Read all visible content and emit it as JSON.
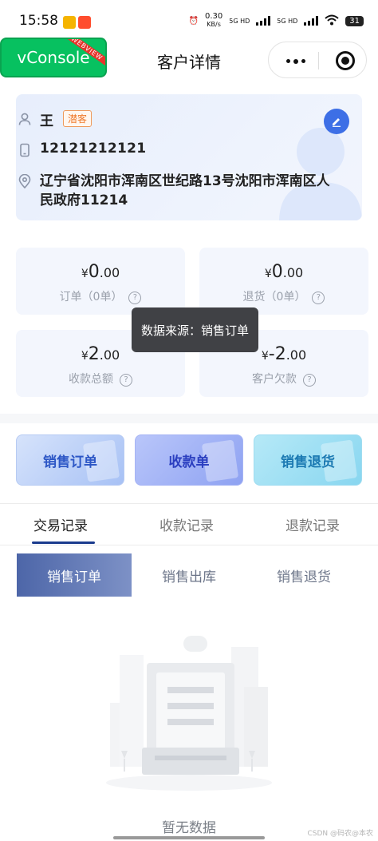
{
  "status_bar": {
    "time": "15:58",
    "network_speed": "0.30",
    "speed_unit": "KB/s",
    "sim1": "5G HD",
    "sim2": "5G HD",
    "battery": "31"
  },
  "nav": {
    "title": "客户详情",
    "vconsole_label": "vConsole",
    "vconsole_ribbon": "WEBVIEW"
  },
  "customer": {
    "name": "王",
    "tag": "潜客",
    "phone": "12121212121",
    "address": "辽宁省沈阳市浑南区世纪路13号沈阳市浑南区人民政府11214"
  },
  "stats": [
    {
      "currency": "¥",
      "int": "0",
      "dec": ".00",
      "label": "订单（0单）"
    },
    {
      "currency": "¥",
      "int": "0",
      "dec": ".00",
      "label": "退货（0单）"
    },
    {
      "currency": "¥",
      "int": "2",
      "dec": ".00",
      "label": "收款总额"
    },
    {
      "currency": "¥",
      "int": "-2",
      "dec": ".00",
      "label": "客户欠款"
    }
  ],
  "tooltip": "数据来源：销售订单",
  "actions": [
    "销售订单",
    "收款单",
    "销售退货"
  ],
  "tabs": [
    "交易记录",
    "收款记录",
    "退款记录"
  ],
  "active_tab": "交易记录",
  "sub_tabs": [
    "销售订单",
    "销售出库",
    "销售退货"
  ],
  "active_sub_tab": "销售订单",
  "empty_text": "暂无数据",
  "watermark": "CSDN @码农@本农",
  "colors": {
    "accent": "#3d6fe6",
    "tag": "#ef7a2c",
    "tooltip_bg": "#404145",
    "active_sub_tab": "#4d66a8"
  }
}
